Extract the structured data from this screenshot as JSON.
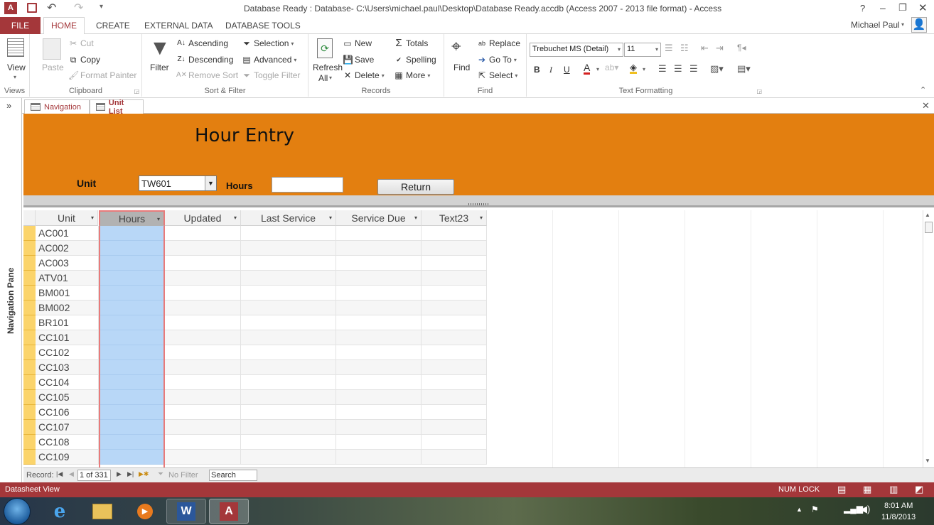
{
  "window": {
    "title": "Database Ready : Database- C:\\Users\\michael.paul\\Desktop\\Database Ready.accdb (Access 2007 - 2013 file format) - Access",
    "help": "?"
  },
  "tabs": [
    "FILE",
    "HOME",
    "CREATE",
    "EXTERNAL DATA",
    "DATABASE TOOLS"
  ],
  "user": "Michael Paul",
  "ribbon": {
    "views": {
      "view": "View",
      "label": "Views"
    },
    "clipboard": {
      "paste": "Paste",
      "cut": "Cut",
      "copy": "Copy",
      "format_painter": "Format Painter",
      "label": "Clipboard"
    },
    "sort_filter": {
      "filter": "Filter",
      "ascending": "Ascending",
      "descending": "Descending",
      "remove_sort": "Remove Sort",
      "selection": "Selection",
      "advanced": "Advanced",
      "toggle_filter": "Toggle Filter",
      "label": "Sort & Filter"
    },
    "records": {
      "refresh": "Refresh",
      "refresh2": "All",
      "new": "New",
      "save": "Save",
      "delete": "Delete",
      "totals": "Totals",
      "spelling": "Spelling",
      "more": "More",
      "label": "Records"
    },
    "find": {
      "find": "Find",
      "replace": "Replace",
      "goto": "Go To",
      "select": "Select",
      "label": "Find"
    },
    "text_formatting": {
      "font": "Trebuchet MS (Detail)",
      "size": "11",
      "label": "Text Formatting",
      "bold": "B",
      "italic": "I",
      "underline": "U"
    }
  },
  "doc_tabs": [
    {
      "label": "Navigation",
      "active": false
    },
    {
      "label": "Unit List",
      "active": true
    }
  ],
  "nav_pane": {
    "label": "Navigation Pane",
    "toggle": "»"
  },
  "form": {
    "title": "Hour Entry",
    "unit_label": "Unit",
    "unit_value": "TW601",
    "hours_label": "Hours",
    "hours_value": "",
    "return_button": "Return"
  },
  "grid": {
    "columns": [
      "Unit",
      "Hours",
      "Updated",
      "Last Service",
      "Service Due",
      "Text23"
    ],
    "rows": [
      "AC001",
      "AC002",
      "AC003",
      "ATV01",
      "BM001",
      "BM002",
      "BR101",
      "CC101",
      "CC102",
      "CC103",
      "CC104",
      "CC105",
      "CC106",
      "CC107",
      "CC108",
      "CC109"
    ]
  },
  "record_nav": {
    "label": "Record:",
    "position": "1 of 331",
    "filter": "No Filter",
    "search": "Search"
  },
  "status": {
    "left": "Datasheet View",
    "numlock": "NUM LOCK"
  },
  "taskbar": {
    "time": "8:01 AM",
    "date": "11/8/2013"
  },
  "colors": {
    "accent": "#a4373a",
    "header": "#e37f10",
    "selected_col": "#b8d7f7",
    "row_selector": "#fbd46b"
  }
}
